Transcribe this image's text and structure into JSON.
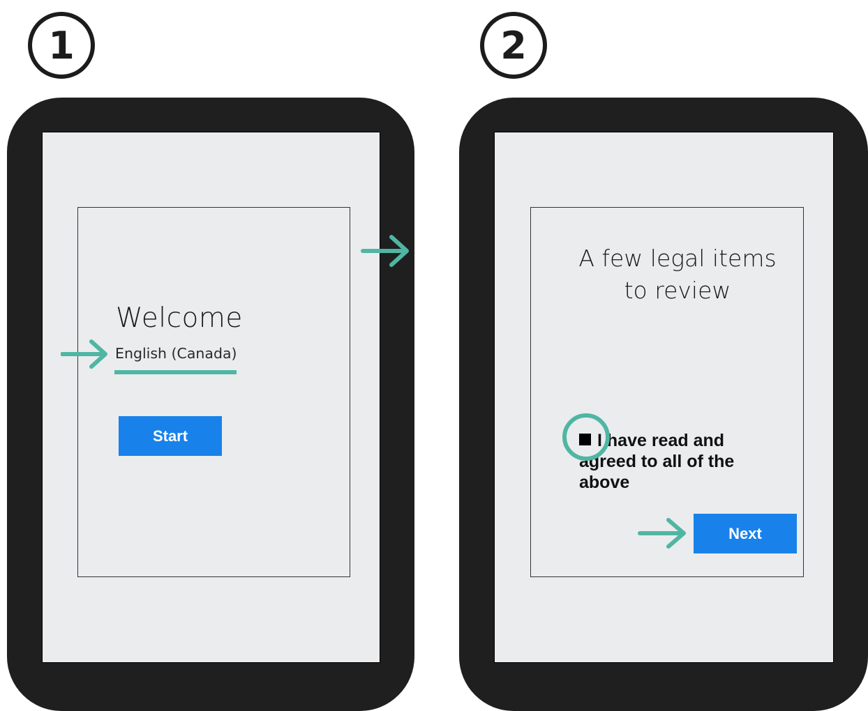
{
  "steps": {
    "first": "1",
    "second": "2"
  },
  "welcome_screen": {
    "title": "Welcome",
    "language": "English (Canada)",
    "start_label": "Start"
  },
  "legal_screen": {
    "title_line1": "A few legal items",
    "title_line2": "to review",
    "agree_text": "I have read and agreed to all of the above",
    "next_label": "Next"
  },
  "colors": {
    "device_frame": "#1f1f1f",
    "screen_bg": "#ebecee",
    "button_blue": "#1882ea",
    "annotation_teal": "#4fb6a3"
  },
  "icons": {
    "arrow": "right-arrow-icon",
    "checkbox": "checkbox-square-icon",
    "ring": "highlight-circle-icon"
  }
}
